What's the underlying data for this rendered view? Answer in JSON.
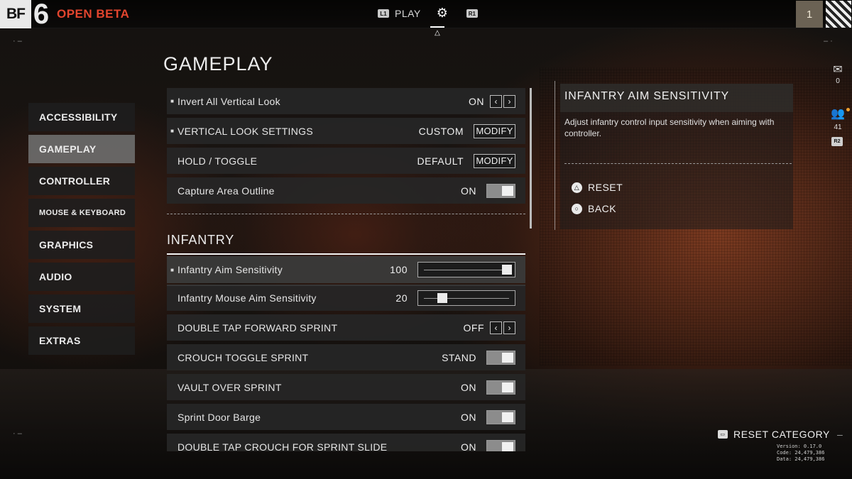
{
  "brand": {
    "logo_prefix": "BF",
    "logo_number": "6",
    "beta_label": "OPEN BETA"
  },
  "top_nav": {
    "left_bumper": "L1",
    "play_label": "PLAY",
    "gear_icon": "gear-icon",
    "right_bumper": "R1",
    "player_level": "1"
  },
  "page": {
    "title": "GAMEPLAY"
  },
  "menu": {
    "items": [
      {
        "label": "ACCESSIBILITY",
        "active": false
      },
      {
        "label": "GAMEPLAY",
        "active": true
      },
      {
        "label": "CONTROLLER",
        "active": false
      },
      {
        "label": "MOUSE & KEYBOARD",
        "active": false
      },
      {
        "label": "GRAPHICS",
        "active": false
      },
      {
        "label": "AUDIO",
        "active": false
      },
      {
        "label": "SYSTEM",
        "active": false
      },
      {
        "label": "EXTRAS",
        "active": false
      }
    ]
  },
  "settings": {
    "top_rows": [
      {
        "label": "Invert All Vertical Look",
        "value": "ON",
        "control": "arrows",
        "bullet": true
      },
      {
        "label": "VERTICAL LOOK SETTINGS",
        "value": "CUSTOM",
        "control": "modify",
        "button_label": "MODIFY",
        "bullet": true
      },
      {
        "label": "HOLD / TOGGLE",
        "value": "DEFAULT",
        "control": "modify",
        "button_label": "MODIFY",
        "bullet": false
      },
      {
        "label": "Capture Area Outline",
        "value": "ON",
        "control": "toggle",
        "bullet": false
      }
    ],
    "section_title": "INFANTRY",
    "infantry_rows": [
      {
        "label": "Infantry Aim Sensitivity",
        "value": "100",
        "control": "slider",
        "slider_fraction": 1.0,
        "bullet": true,
        "focused": true
      },
      {
        "label": "Infantry Mouse Aim Sensitivity",
        "value": "20",
        "control": "slider",
        "slider_fraction": 0.2,
        "bullet": false
      },
      {
        "label": "DOUBLE TAP FORWARD SPRINT",
        "value": "OFF",
        "control": "arrows",
        "bullet": false
      },
      {
        "label": "CROUCH TOGGLE SPRINT",
        "value": "STAND",
        "control": "toggle",
        "bullet": false
      },
      {
        "label": "VAULT OVER SPRINT",
        "value": "ON",
        "control": "toggle",
        "bullet": false
      },
      {
        "label": "Sprint Door Barge",
        "value": "ON",
        "control": "toggle",
        "bullet": false
      },
      {
        "label": "DOUBLE TAP CROUCH FOR SPRINT SLIDE",
        "value": "ON",
        "control": "toggle",
        "bullet": false
      }
    ]
  },
  "info_panel": {
    "title": "INFANTRY AIM SENSITIVITY",
    "description": "Adjust infantry control input sensitivity when aiming with controller.",
    "reset_label": "RESET",
    "back_label": "BACK"
  },
  "side_panel": {
    "mail_count": "0",
    "friends_count": "41",
    "r2_label": "R2"
  },
  "footer": {
    "reset_category_label": "RESET CATEGORY",
    "version_line": "Version: 0.17.0",
    "code_line": "Code: 24,479,386",
    "data_line": "Data: 24,479,386"
  },
  "colors": {
    "accent_red": "#e2452e",
    "row_bg": "#262626",
    "active_menu_bg": "#6e6e6e"
  }
}
